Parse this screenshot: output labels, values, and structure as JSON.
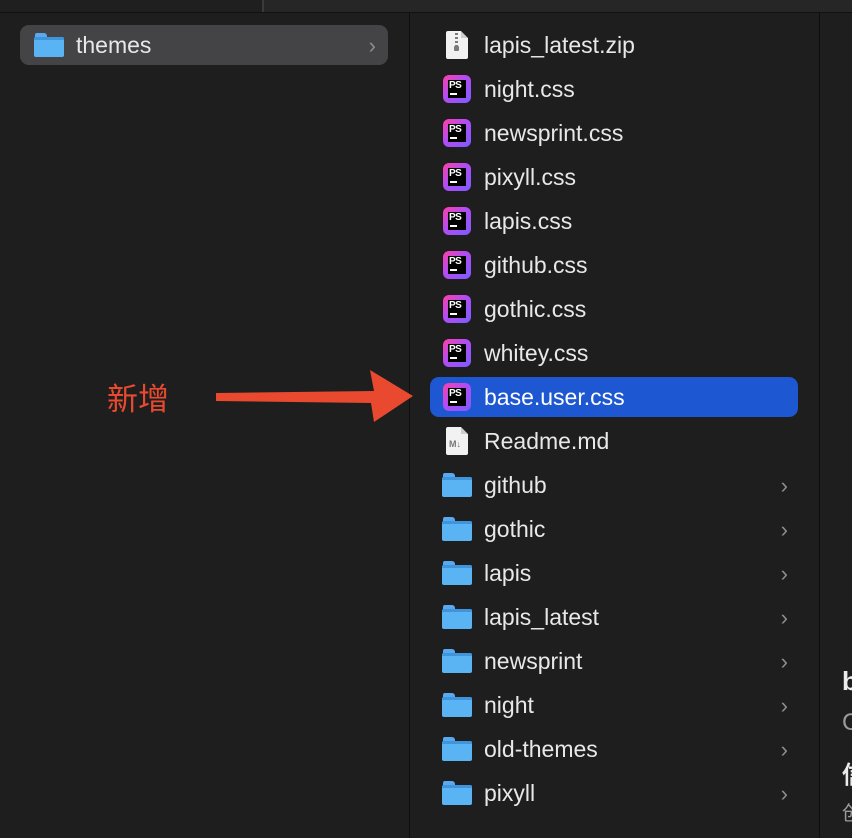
{
  "colors": {
    "background": "#1e1e1e",
    "selected_row": "#444446",
    "active_row": "#1d57d1",
    "annotation": "#e94a2f",
    "folder": "#5ab4f4"
  },
  "column1": {
    "items": [
      {
        "label": "themes",
        "icon": "folder-icon",
        "has_chevron": true,
        "selected": true
      }
    ]
  },
  "column2": {
    "items": [
      {
        "label": "lapis_latest.zip",
        "icon": "zip-file-icon"
      },
      {
        "label": "night.css",
        "icon": "phpstorm-file-icon"
      },
      {
        "label": "newsprint.css",
        "icon": "phpstorm-file-icon"
      },
      {
        "label": "pixyll.css",
        "icon": "phpstorm-file-icon"
      },
      {
        "label": "lapis.css",
        "icon": "phpstorm-file-icon"
      },
      {
        "label": "github.css",
        "icon": "phpstorm-file-icon"
      },
      {
        "label": "gothic.css",
        "icon": "phpstorm-file-icon"
      },
      {
        "label": "whitey.css",
        "icon": "phpstorm-file-icon"
      },
      {
        "label": "base.user.css",
        "icon": "phpstorm-file-icon",
        "active": true
      },
      {
        "label": "Readme.md",
        "icon": "markdown-file-icon"
      },
      {
        "label": "github",
        "icon": "folder-icon",
        "has_chevron": true
      },
      {
        "label": "gothic",
        "icon": "folder-icon",
        "has_chevron": true
      },
      {
        "label": "lapis",
        "icon": "folder-icon",
        "has_chevron": true
      },
      {
        "label": "lapis_latest",
        "icon": "folder-icon",
        "has_chevron": true
      },
      {
        "label": "newsprint",
        "icon": "folder-icon",
        "has_chevron": true
      },
      {
        "label": "night",
        "icon": "folder-icon",
        "has_chevron": true
      },
      {
        "label": "old-themes",
        "icon": "folder-icon",
        "has_chevron": true
      },
      {
        "label": "pixyll",
        "icon": "folder-icon",
        "has_chevron": true
      }
    ]
  },
  "annotation": {
    "text": "新增",
    "pointer": "arrow-right-icon"
  },
  "preview_column": {
    "peek": [
      "b",
      "C",
      "信",
      "创"
    ]
  },
  "chevron_glyph": "›",
  "ps_glyph": "PS",
  "md_glyph": "M↓"
}
